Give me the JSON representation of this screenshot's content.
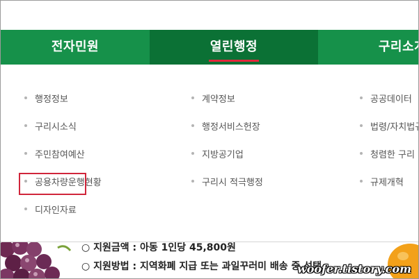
{
  "nav": {
    "tabs": [
      {
        "label": "전자민원",
        "active": false
      },
      {
        "label": "열린행정",
        "active": true
      },
      {
        "label": "구리소개",
        "active": false
      }
    ]
  },
  "menu": {
    "columns": [
      [
        "행정정보",
        "구리시소식",
        "주민참여예산",
        "공용차량운행현황",
        "디자인자료"
      ],
      [
        "계약정보",
        "행정서비스헌장",
        "지방공기업",
        "구리시 적극행정"
      ],
      [
        "공공데이터",
        "법령/자치법규",
        "청렴한 구리",
        "규제개혁"
      ]
    ],
    "highlighted_item": "구리시소식"
  },
  "banner": {
    "line1": "○ 지원금액 : 아동 1인당 45,800원",
    "line2": "○ 지원방법 : 지역화폐 지급 또는 과일꾸러미 배송 중 선택"
  },
  "watermark": "woofer.tistory.com",
  "colors": {
    "nav_green": "#16914a",
    "nav_active": "#0b7135",
    "underline_red": "#e3283b",
    "highlight_red": "#d0253a"
  }
}
